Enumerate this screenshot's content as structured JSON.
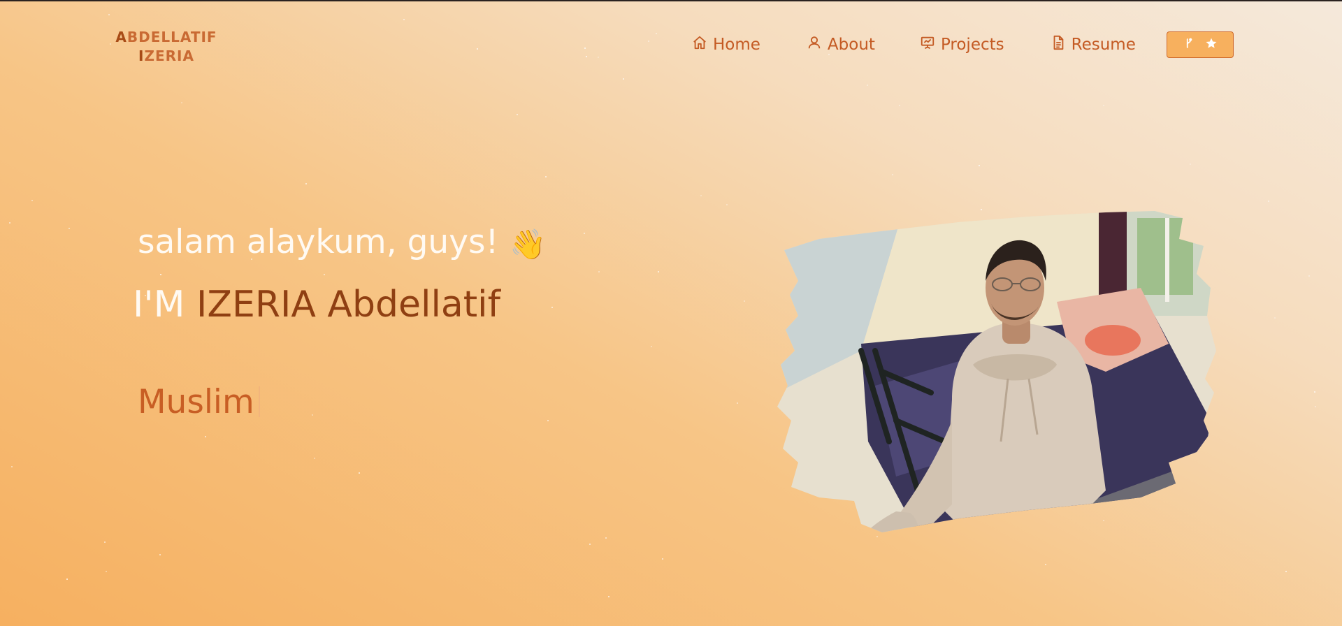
{
  "brand": {
    "line1_cap": "A",
    "line1_rest": "BDELLATIF",
    "line2_cap": "I",
    "line2_rest": "ZERIA"
  },
  "nav": {
    "items": [
      {
        "label": "Home",
        "icon": "home-icon"
      },
      {
        "label": "About",
        "icon": "user-icon"
      },
      {
        "label": "Projects",
        "icon": "presentation-icon"
      },
      {
        "label": "Resume",
        "icon": "document-icon"
      }
    ],
    "github_button": {
      "icons": [
        "git-fork-icon",
        "star-icon"
      ]
    }
  },
  "hero": {
    "greeting": "salam alaykum, guys!",
    "wave_emoji": "👋",
    "intro_prefix": "I'M",
    "name": "IZERIA Abdellatif",
    "typed_text": "Muslim"
  },
  "colors": {
    "accent": "#c45a23",
    "name": "#8f3f12",
    "button_bg": "#f7b05e"
  },
  "photo": {
    "description_icon": "profile-photo"
  }
}
